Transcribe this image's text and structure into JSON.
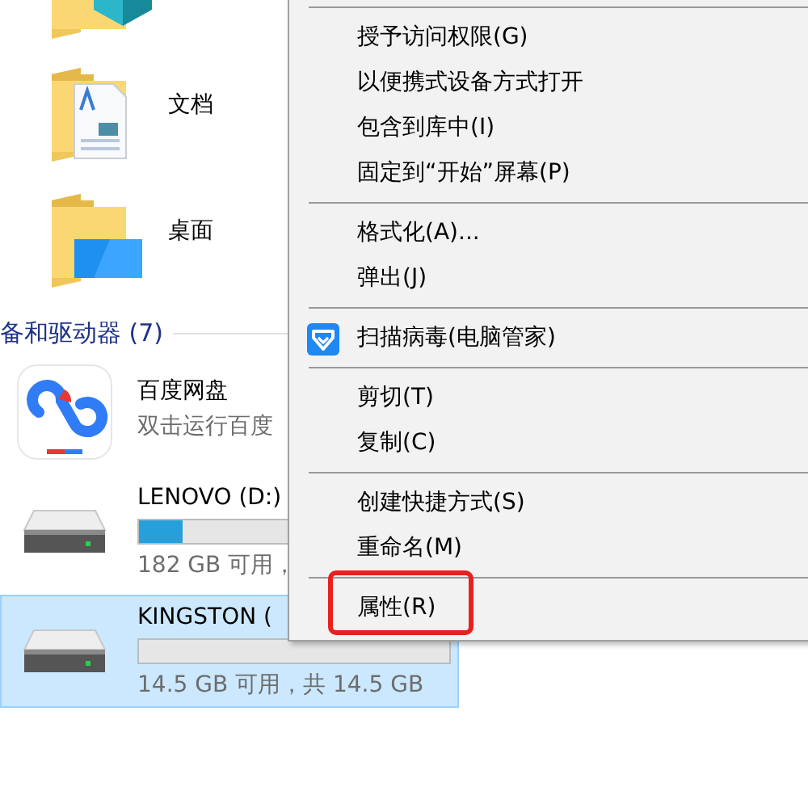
{
  "nav": {
    "folders": [
      {
        "kind": "objects3d"
      },
      {
        "kind": "documents",
        "label": "文档"
      },
      {
        "kind": "desktop",
        "label": "桌面"
      }
    ],
    "section": {
      "title": "备和驱动器 (7)"
    },
    "drives": [
      {
        "kind": "app",
        "name": "百度网盘",
        "detail": "双击运行百度",
        "selected": false
      },
      {
        "kind": "drive",
        "name": "LENOVO (D:)",
        "level": 0.14,
        "detail": "182 GB 可用，",
        "selected": false
      },
      {
        "kind": "drive",
        "name": "KINGSTON (",
        "level": 0,
        "detail": "14.5 GB 可用，共 14.5 GB",
        "selected": true
      }
    ]
  },
  "context_menu": {
    "items": [
      {
        "kind": "separator"
      },
      {
        "kind": "item",
        "label": "授予访问权限(G)"
      },
      {
        "kind": "item",
        "label": "以便携式设备方式打开"
      },
      {
        "kind": "item",
        "label": "包含到库中(I)"
      },
      {
        "kind": "item",
        "label": "固定到“开始”屏幕(P)"
      },
      {
        "kind": "separator"
      },
      {
        "kind": "item",
        "label": "格式化(A)..."
      },
      {
        "kind": "item",
        "label": "弹出(J)"
      },
      {
        "kind": "separator"
      },
      {
        "kind": "shield",
        "label": "扫描病毒(电脑管家)"
      },
      {
        "kind": "separator"
      },
      {
        "kind": "item",
        "label": "剪切(T)"
      },
      {
        "kind": "item",
        "label": "复制(C)"
      },
      {
        "kind": "separator"
      },
      {
        "kind": "item",
        "label": "创建快捷方式(S)"
      },
      {
        "kind": "item",
        "label": "重命名(M)"
      },
      {
        "kind": "separator"
      },
      {
        "kind": "item",
        "label": "属性(R)",
        "highlighted": true
      }
    ]
  }
}
